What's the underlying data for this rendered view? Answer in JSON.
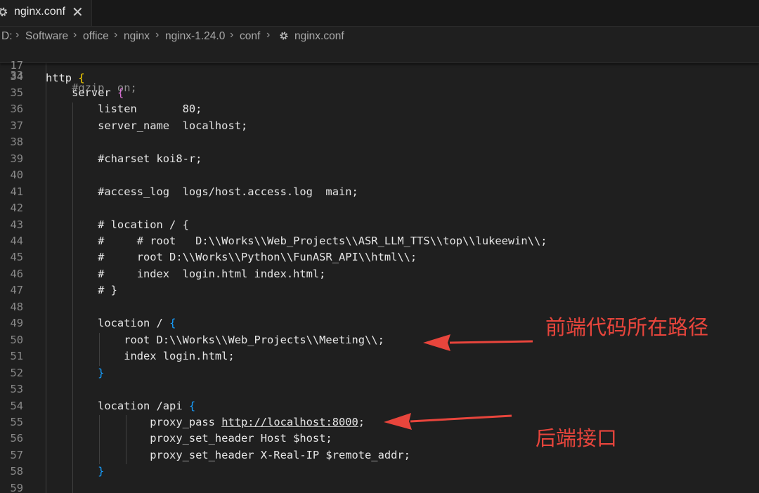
{
  "tab": {
    "filename": "nginx.conf",
    "close_glyph": "✕",
    "icon": "gear-icon"
  },
  "breadcrumb": {
    "items": [
      "D:",
      "Software",
      "office",
      "nginx",
      "nginx-1.24.0",
      "conf",
      "nginx.conf"
    ],
    "separator": "›",
    "file_icon": "gear-icon"
  },
  "editor": {
    "sticky": {
      "number": "17",
      "text": "http ",
      "brace": "{"
    },
    "partial_top": "    #gzip  on;",
    "lines": [
      {
        "n": "34",
        "t": ""
      },
      {
        "n": "35",
        "t": "    server ",
        "b": "{",
        "bc": "pink"
      },
      {
        "n": "36",
        "t": "        listen       80;"
      },
      {
        "n": "37",
        "t": "        server_name  localhost;"
      },
      {
        "n": "38",
        "t": ""
      },
      {
        "n": "39",
        "t": "        #charset koi8-r;"
      },
      {
        "n": "40",
        "t": ""
      },
      {
        "n": "41",
        "t": "        #access_log  logs/host.access.log  main;"
      },
      {
        "n": "42",
        "t": ""
      },
      {
        "n": "43",
        "t": "        # location / {"
      },
      {
        "n": "44",
        "t": "        #     # root   D:\\\\Works\\\\Web_Projects\\\\ASR_LLM_TTS\\\\top\\\\lukeewin\\\\;"
      },
      {
        "n": "45",
        "t": "        #     root D:\\\\Works\\\\Python\\\\FunASR_API\\\\html\\\\;"
      },
      {
        "n": "46",
        "t": "        #     index  login.html index.html;"
      },
      {
        "n": "47",
        "t": "        # }"
      },
      {
        "n": "48",
        "t": ""
      },
      {
        "n": "49",
        "t": "        location / ",
        "b": "{",
        "bc": "blue"
      },
      {
        "n": "50",
        "t": "            root D:\\\\Works\\\\Web_Projects\\\\Meeting\\\\;"
      },
      {
        "n": "51",
        "t": "            index login.html;"
      },
      {
        "n": "52",
        "t": "        ",
        "b": "}",
        "bc": "blue"
      },
      {
        "n": "53",
        "t": ""
      },
      {
        "n": "54",
        "t": "        location /api ",
        "b": "{",
        "bc": "blue"
      },
      {
        "n": "55",
        "t": "                proxy_pass ",
        "u": "http://localhost:8000",
        "after": ";"
      },
      {
        "n": "56",
        "t": "                proxy_set_header Host $host;"
      },
      {
        "n": "57",
        "t": "                proxy_set_header X-Real-IP $remote_addr;"
      },
      {
        "n": "58",
        "t": "        ",
        "b": "}",
        "bc": "blue"
      },
      {
        "n": "59",
        "t": ""
      }
    ]
  },
  "annotations": [
    {
      "text": "前端代码所在路径"
    },
    {
      "text": "后端接口"
    }
  ],
  "colors": {
    "annotation": "#e8453c",
    "gold_brace": "#ffd700",
    "pink_brace": "#da70d6",
    "blue_brace": "#179fff"
  }
}
